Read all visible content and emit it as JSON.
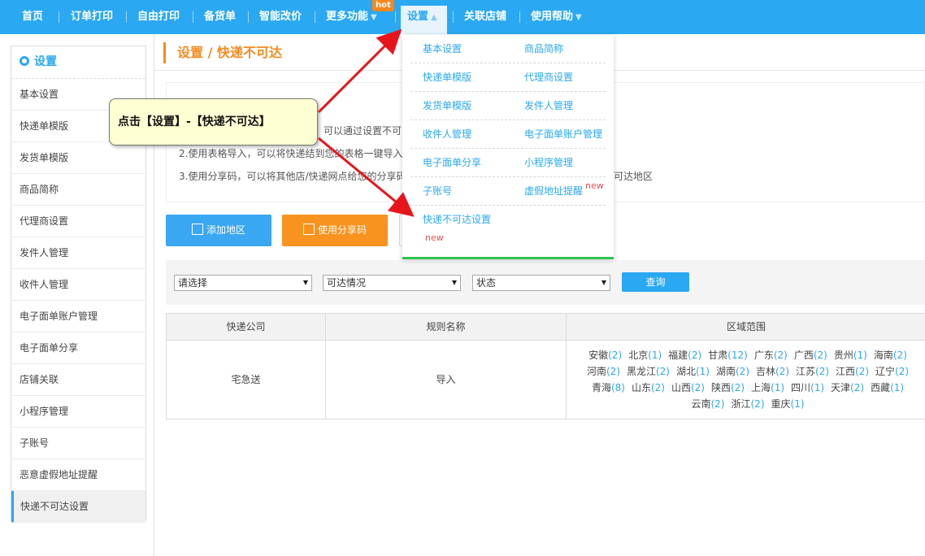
{
  "nav": {
    "items": [
      "首页",
      "订单打印",
      "自由打印",
      "备货单",
      "智能改价",
      "更多功能",
      "设置",
      "关联店铺",
      "使用帮助"
    ],
    "hot_badge": "hot",
    "arrow": "▼",
    "active_arrow": "▲"
  },
  "sidebar": {
    "title": "设置",
    "items": [
      "基本设置",
      "快递单模版",
      "发货单模版",
      "商品简称",
      "代理商设置",
      "发件人管理",
      "收件人管理",
      "电子面单账户管理",
      "电子面单分享",
      "店铺关联",
      "小程序管理",
      "子账号",
      "恶意虚假地址提醒",
      "快递不可达设置"
    ]
  },
  "page": {
    "title": "设置 / 快递不可达"
  },
  "instructions": {
    "line1": "可以通过设置不可",
    "line2": "2.使用表格导入，可以将快递结到您的表格一键导入",
    "line3": "3.使用分享码，可以将其他店/快递网点给您的分享码",
    "line3_tail": "可达地区"
  },
  "buttons": {
    "add_region": "添加地区",
    "use_share_code": "使用分享码"
  },
  "filters": {
    "select1": "请选择",
    "select2": "可达情况",
    "select3": "状态",
    "query": "查询"
  },
  "table": {
    "headers": [
      "快递公司",
      "规则名称",
      "区域范围"
    ],
    "row": {
      "company": "宅急送",
      "rule": "导入",
      "regions": [
        [
          "安徽",
          "(2)"
        ],
        [
          "北京",
          "(1)"
        ],
        [
          "福建",
          "(2)"
        ],
        [
          "甘肃",
          "(12)"
        ],
        [
          "广东",
          "(2)"
        ],
        [
          "广西",
          "(2)"
        ],
        [
          "贵州",
          "(1)"
        ],
        [
          "海南",
          "(2)"
        ],
        [
          "河南",
          "(2)"
        ],
        [
          "黑龙江",
          "(2)"
        ],
        [
          "湖北",
          "(1)"
        ],
        [
          "湖南",
          "(2)"
        ],
        [
          "吉林",
          "(2)"
        ],
        [
          "江苏",
          "(2)"
        ],
        [
          "江西",
          "(2)"
        ],
        [
          "辽宁",
          "(2)"
        ],
        [
          "青海",
          "(8)"
        ],
        [
          "山东",
          "(2)"
        ],
        [
          "山西",
          "(2)"
        ],
        [
          "陕西",
          "(2)"
        ],
        [
          "上海",
          "(1)"
        ],
        [
          "四川",
          "(1)"
        ],
        [
          "天津",
          "(2)"
        ],
        [
          "西藏",
          "(1)"
        ],
        [
          "云南",
          "(2)"
        ],
        [
          "浙江",
          "(2)"
        ],
        [
          "重庆",
          "(1)"
        ]
      ]
    }
  },
  "dropdown": {
    "rows": [
      [
        "基本设置",
        "商品简称"
      ],
      [
        "快递单模版",
        "代理商设置"
      ],
      [
        "发货单模版",
        "发件人管理"
      ],
      [
        "收件人管理",
        "电子面单账户管理"
      ],
      [
        "电子面单分享",
        "小程序管理"
      ],
      [
        "子账号",
        "虚假地址提醒"
      ]
    ],
    "last_item": "快递不可达设置",
    "new_label": "new"
  },
  "callout": {
    "text": "点击【设置】-【快递不可达】"
  },
  "colors": {
    "nav_bg": "#2aa8f2",
    "accent_orange": "#f58a1f",
    "arrow_red": "#e8141b",
    "new_red": "#f04f4f"
  }
}
